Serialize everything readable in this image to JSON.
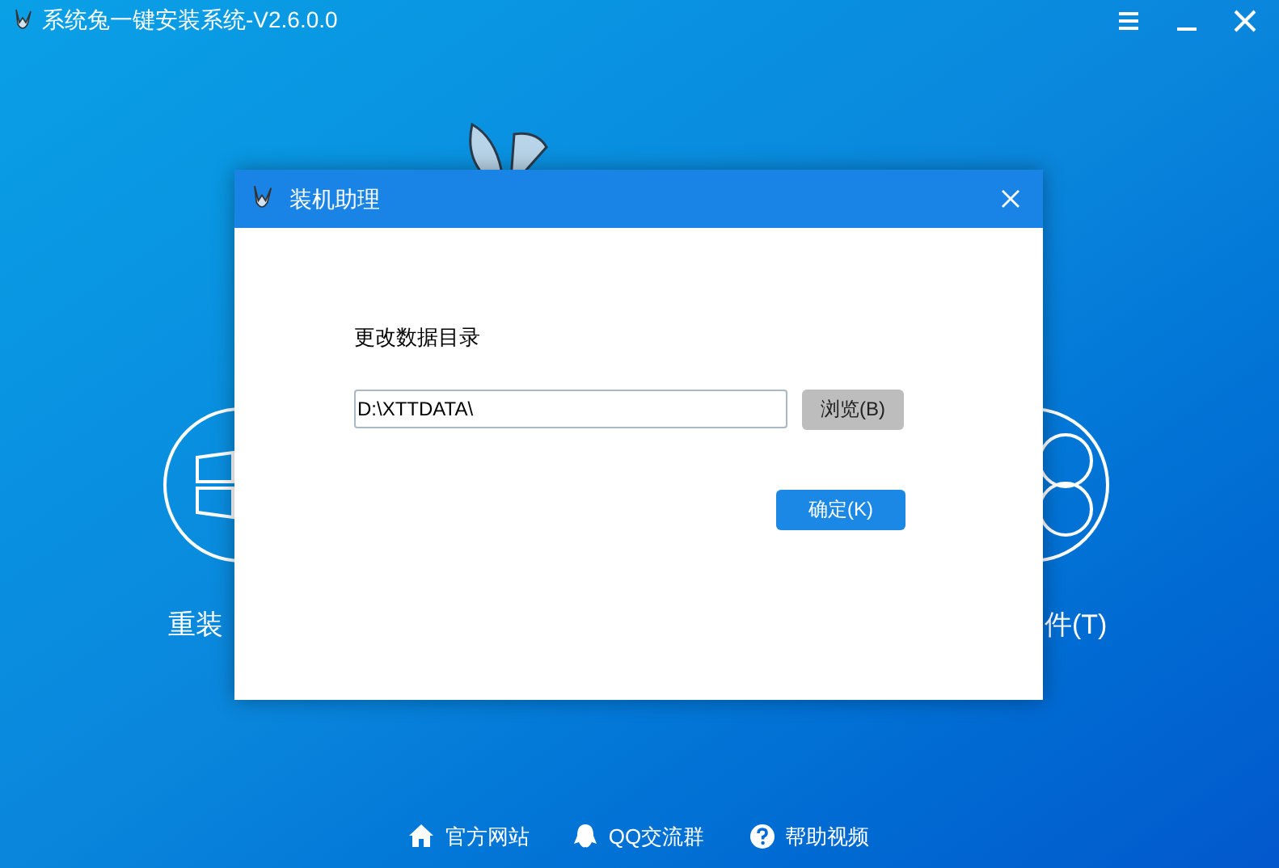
{
  "window": {
    "title": "系统兔一键安装系统-V2.6.0.0"
  },
  "background_options": [
    {
      "label": "重装",
      "kind": "windows"
    },
    {
      "label": "件(T)",
      "kind": "usb"
    }
  ],
  "dialog": {
    "title": "装机助理",
    "label": "更改数据目录",
    "path_field": {
      "value": "D:\\XTTDATA\\"
    },
    "browse_button": "浏览(B)",
    "ok_button": "确定(K)"
  },
  "footer_links": [
    {
      "label": "官方网站",
      "kind": "home"
    },
    {
      "label": "QQ交流群",
      "kind": "qq"
    },
    {
      "label": "帮助视频",
      "kind": "help"
    }
  ]
}
